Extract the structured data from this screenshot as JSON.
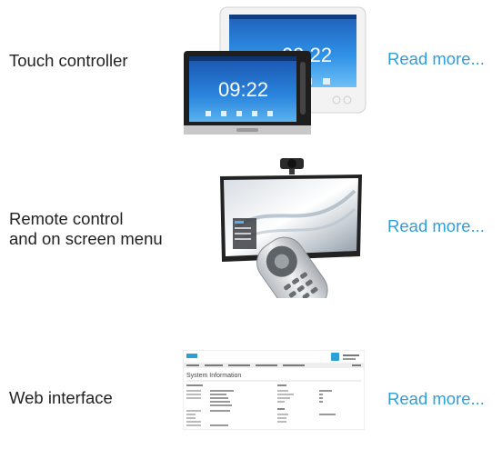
{
  "rows": [
    {
      "label": "Touch controller",
      "link": "Read more...",
      "screen_time_front": "09:22",
      "screen_time_back": "09:22"
    },
    {
      "label_line1": "Remote control",
      "label_line2": "and on screen menu",
      "link": "Read more..."
    },
    {
      "label": "Web interface",
      "link": "Read more...",
      "web_title": "System Information"
    }
  ],
  "colors": {
    "link": "#2d9fd9",
    "text": "#222222",
    "screen_blue": "#1a78d6"
  }
}
